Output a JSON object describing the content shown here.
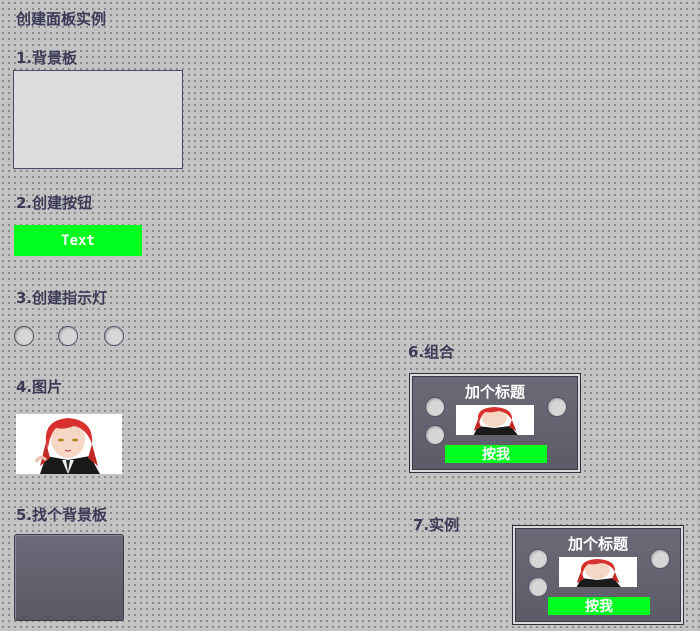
{
  "title": "创建面板实例",
  "sections": {
    "s1": "1.背景板",
    "s2": "2.创建按钮",
    "s3": "3.创建指示灯",
    "s4": "4.图片",
    "s5": "5.找个背景板",
    "s6": "6.组合",
    "s7": "7.实例"
  },
  "button": {
    "label": "Text"
  },
  "group": {
    "title": "加个标题",
    "button_label": "按我"
  },
  "instance": {
    "title": "加个标题",
    "button_label": "按我"
  },
  "colors": {
    "accent_green": "#00ff1e",
    "panel_dark": "#5f5f6b",
    "label_text": "#3b3b58"
  },
  "image": {
    "subject": "anime-girl-red-hair"
  }
}
